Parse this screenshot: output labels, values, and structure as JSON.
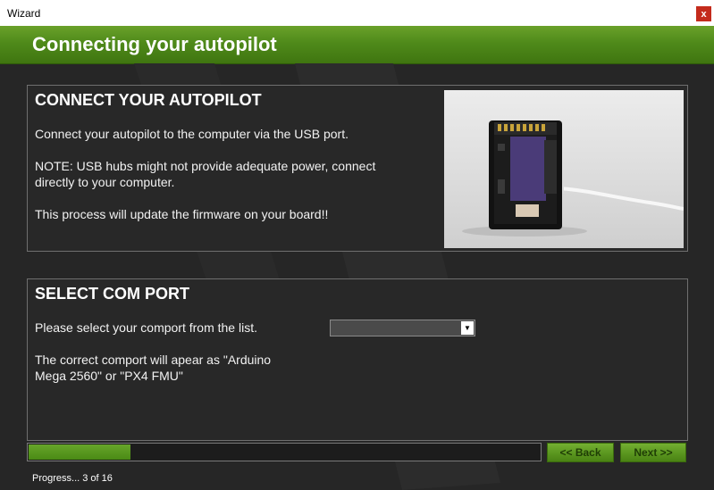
{
  "window": {
    "title": "Wizard",
    "close_label": "x"
  },
  "header": {
    "title": "Connecting your autopilot"
  },
  "connect_panel": {
    "heading": "CONNECT YOUR AUTOPILOT",
    "instruction": "Connect your autopilot to the computer via the USB port.",
    "note_line1": "NOTE: USB hubs might not provide adequate power, connect",
    "note_line2": "directly to your computer.",
    "warning": "This process will update the firmware on your board!!"
  },
  "comport_panel": {
    "heading": "SELECT COM PORT",
    "prompt": "Please select your comport from the list.",
    "selected_value": "",
    "hint_line1": "The correct comport will apear as \"Arduino",
    "hint_line2": "Mega 2560\" or \"PX4 FMU\""
  },
  "footer": {
    "progress_fraction": 0.2,
    "back_label": "<< Back",
    "next_label": "Next >>",
    "status_text": "Progress... 3 of 16"
  },
  "colors": {
    "accent": "#4f8a1a",
    "background": "#262626"
  }
}
